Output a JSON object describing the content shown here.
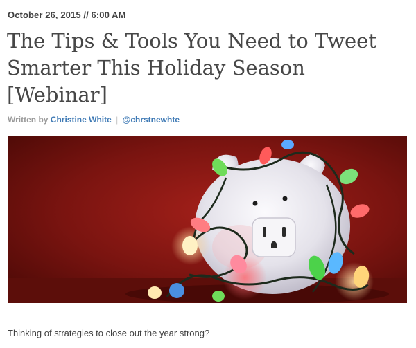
{
  "post": {
    "date": "October 26, 2015 // 6:00 AM",
    "title": "The Tips & Tools You Need to Tweet Smarter This Holiday Season [Webinar]",
    "byline": {
      "prefix": "Written by",
      "author": "Christine White",
      "separator": "|",
      "handle": "@chrstnewhte"
    },
    "hero_image": {
      "subject": "piggy-bank-with-christmas-lights",
      "colors": {
        "background": "#7a1410",
        "pig": "#e8e6ee",
        "wire": "#1d2a1c"
      }
    },
    "intro": "Thinking of strategies to close out the year strong?"
  },
  "colors": {
    "link": "#3f7ab5",
    "title": "#474747",
    "meta": "#9a9a9a"
  }
}
